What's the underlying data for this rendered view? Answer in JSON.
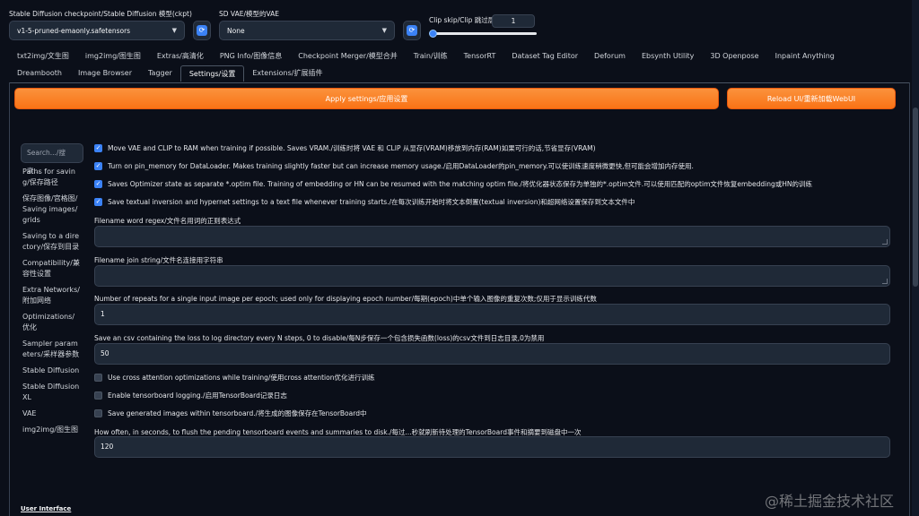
{
  "header": {
    "checkpoint_label": "Stable Diffusion checkpoint/Stable Diffusion 模型(ckpt)",
    "checkpoint_value": "v1-5-pruned-emaonly.safetensors",
    "vae_label": "SD VAE/模型的VAE",
    "vae_value": "None",
    "clip_label": "Clip skip/Clip 跳过层",
    "clip_value": "1",
    "clip_slider_fraction": 0,
    "refresh_icon": "refresh-icon",
    "caret_icon": "chevron-down-icon"
  },
  "tabs": {
    "row1": [
      "txt2img/文生图",
      "img2img/图生图",
      "Extras/高清化",
      "PNG Info/图像信息",
      "Checkpoint Merger/模型合并",
      "Train/训练",
      "TensorRT",
      "Dataset Tag Editor",
      "Deforum",
      "Ebsynth Utility",
      "3D Openpose",
      "Inpaint Anything"
    ],
    "row2": [
      "Dreambooth",
      "Image Browser",
      "Tagger",
      "Settings/设置",
      "Extensions/扩展插件"
    ],
    "active": "Settings/设置"
  },
  "actions": {
    "apply": "Apply settings/应用设置",
    "reload": "Reload UI/重新加载WebUI"
  },
  "sidebar": {
    "search_placeholder": "Search.../搜索...",
    "items": [
      "Paths for saving/保存路径",
      "保存图像/宫格图/Saving images/grids",
      "Saving to a directory/保存到目录",
      "Compatibility/兼容性设置",
      "Extra Networks/附加网络",
      "Optimizations/优化",
      "Sampler parameters/采样器参数",
      "Stable Diffusion",
      "Stable Diffusion XL",
      "VAE",
      "img2img/图生图"
    ],
    "user_interface": "User Interface"
  },
  "settings": {
    "move_vae": "Move VAE and CLIP to RAM when training if possible. Saves VRAM./训练时将 VAE 和 CLIP 从显存(VRAM)移放到内存(RAM)如果可行的话,节省显存(VRAM)",
    "pin_memory": "Turn on pin_memory for DataLoader. Makes training slightly faster but can increase memory usage./启用DataLoader的pin_memory.可以使训练速度稍微更快,但可能会增加内存使用.",
    "optim_state": "Saves Optimizer state as separate *.optim file. Training of embedding or HN can be resumed with the matching optim file./将优化器状态保存为单独的*.optim文件.可以使用匹配的optim文件恢复embedding或HN的训练",
    "save_textual": "Save textual inversion and hypernet settings to a text file whenever training starts./在每次训练开始时将文本倒置(textual inversion)和超网络设置保存到文本文件中",
    "word_regex_label": "Filename word regex/文件名用词的正则表达式",
    "join_string_label": "Filename join string/文件名连接用字符串",
    "repeats_label": "Number of repeats for a single input image per epoch; used only for displaying epoch number/每期(epoch)中单个输入图像的重复次数;仅用于显示训练代数",
    "repeats_value": "1",
    "csv_label": "Save an csv containing the loss to log directory every N steps, 0 to disable/每N步保存一个包含损失函数(loss)的csv文件到日志目录,0为禁用",
    "csv_value": "50",
    "cross_attention": "Use cross attention optimizations while training/使用cross attention优化进行训练",
    "tensorboard_logging": "Enable tensorboard logging./启用TensorBoard记录日志",
    "tensorboard_images": "Save generated images within tensorboard./将生成的图像保存在TensorBoard中",
    "flush_label": "How often, in seconds, to flush the pending tensorboard events and summaries to disk./每过...秒就刷新待处理的TensorBoard事件和摘要到磁盘中一次",
    "flush_value": "120"
  },
  "watermark": "@稀土掘金技术社区",
  "colors": {
    "accent": "#f97316",
    "checkbox": "#3b82f6",
    "background": "#0b0f19"
  }
}
